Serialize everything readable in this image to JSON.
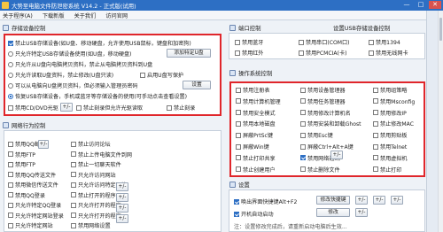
{
  "window": {
    "title": "大势至电脑文件防泄密系统 V14.2 - 正式版(试用)",
    "controls": [
      "—",
      "□",
      "✕"
    ]
  },
  "menu": [
    "关于程序(A)",
    "下载新版",
    "关于我们",
    "访问官网"
  ],
  "storage": {
    "title": "存储设备控制",
    "options": [
      {
        "text": "禁止USB存储设备(如U盘、移动硬盘，允许使用USB鼠标，键盘和加密狗)",
        "kind": "check",
        "checked": true
      },
      {
        "text": "只允许特定USB存储设备使用(如U盘，移动硬盘)",
        "kind": "radio",
        "checked": false
      },
      {
        "text": "只允许从U盘向电脑拷贝资料，禁止从电脑拷贝资料到U盘",
        "kind": "radio",
        "checked": false
      },
      {
        "text": "只允许读取U盘资料，禁止修改(U盘只读)",
        "kind": "radio",
        "checked": false
      },
      {
        "text": "可以从电脑向U盘拷贝资料，但必须输入管理员密码",
        "kind": "radio",
        "checked": false
      },
      {
        "text": "恢复USB存储设备，手机或蓝牙等存储设备的使用(可手动点击查看设置)",
        "kind": "radio",
        "checked": true
      },
      {
        "text": "禁用CD/DVD光驱",
        "kind": "check",
        "checked": false
      }
    ],
    "add_device_label": "添加特定U盘",
    "enable_usb_write_label": "启用U盘写保护",
    "settings_label": "设置",
    "burn_label": "禁止刻录",
    "plusminus": "+/-",
    "cd_extra": "禁止刻录但允许光驱读取"
  },
  "network": {
    "title": "网络行为控制",
    "col1": [
      "禁用QQ邮件",
      "禁用FTP",
      "禁用FTP",
      "禁用QQ传送文件",
      "禁用微信传送文件",
      "禁用QQ登录",
      "只允许特定QQ登录",
      "只允许特定网站登录",
      "只允许特定网站"
    ],
    "col2": [
      "禁止访问论坛",
      "禁止上传电脑文件到网",
      "禁止一切聊天软件",
      "只允许访问网站",
      "只允许访问特定网站",
      "禁止打开的程序",
      "只允许打开的程序",
      "只允许打开的程序",
      "禁用网络设置"
    ],
    "col1_checked": [
      false,
      false,
      false,
      false,
      false,
      false,
      false,
      false,
      false
    ],
    "col2_checked": [
      false,
      false,
      false,
      false,
      false,
      false,
      false,
      false,
      false
    ]
  },
  "port": {
    "title": "端口控制",
    "settings_title": "设置USB存储设备控制",
    "items": [
      [
        "禁用蓝牙",
        "禁用串口(COM口)",
        "禁用1394"
      ],
      [
        "禁用红外",
        "禁用PCMCIA(卡)",
        "禁用无线网卡"
      ]
    ]
  },
  "os": {
    "title": "操作系统控制",
    "rows": [
      [
        "禁用注册表",
        "禁用设备管理器",
        "禁用组策略"
      ],
      [
        "禁用计算机管理",
        "禁用任务管理器",
        "禁用Msconfig"
      ],
      [
        "禁用安全模式",
        "禁用修改计算机名",
        "禁用修改IP"
      ],
      [
        "禁用本地磁盘",
        "禁用安装和卸载Ghost",
        "禁止修改MAC"
      ],
      [
        "屏蔽PrtSc键",
        "禁用Esc键",
        "禁用剪贴板"
      ],
      [
        "屏蔽Win键",
        "屏蔽Ctrl+Alt+A键",
        "禁用Telnet"
      ],
      [
        "禁止打印共享",
        "禁用网络通讯",
        "禁用虚拟机"
      ],
      [
        "禁止创建用户",
        "禁止删除文件",
        "禁止打印"
      ]
    ],
    "checked": [
      [
        false,
        false,
        false
      ],
      [
        false,
        false,
        false
      ],
      [
        false,
        false,
        false
      ],
      [
        false,
        false,
        false
      ],
      [
        false,
        false,
        false
      ],
      [
        false,
        false,
        false
      ],
      [
        false,
        true,
        false
      ],
      [
        false,
        false,
        false
      ]
    ]
  },
  "settings": {
    "title": "设置",
    "hotkey_label": "唤出界面快捷键Alt+F2",
    "change_hotkey": "修改快捷键",
    "autostart_label": "开机自动启动",
    "modify_label": "修改",
    "footer": "注：设置修改完成后，请重新启动电脑后生效...",
    "bottom_btns": [
      "+/-",
      "+/-",
      "+/-",
      "+/-"
    ]
  },
  "colors": {
    "title": "#2d6fc4",
    "highlight": "#e0262b"
  }
}
